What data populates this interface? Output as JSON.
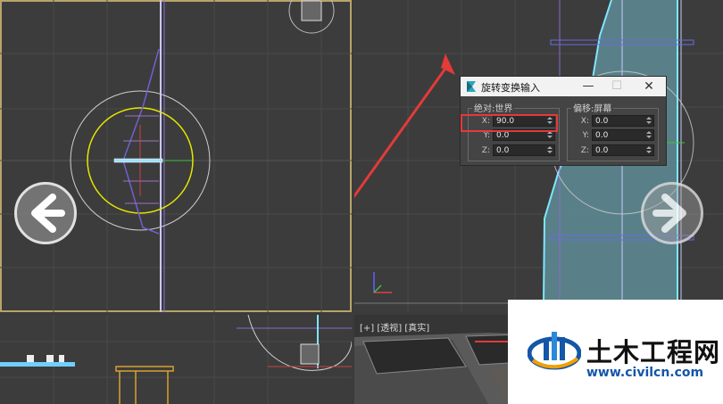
{
  "dialog": {
    "title": "旋转变换输入",
    "minimize_glyph": "—",
    "maximize_glyph": "☐",
    "close_glyph": "✕",
    "absolute": {
      "title": "绝对:世界",
      "x_label": "X:",
      "x_value": "90.0",
      "y_label": "Y:",
      "y_value": "0.0",
      "z_label": "Z:",
      "z_value": "0.0"
    },
    "offset": {
      "title": "偏移:屏幕",
      "x_label": "X:",
      "x_value": "0.0",
      "y_label": "Y:",
      "y_value": "0.0",
      "z_label": "Z:",
      "z_value": "0.0"
    }
  },
  "viewports": {
    "perspective_label": "[+] [透视] [真实]"
  },
  "navigation": {
    "prev_icon": "arrow-left-icon",
    "next_icon": "arrow-right-icon"
  },
  "watermark": {
    "brand": "土木工程网",
    "url": "www.civilcn.com"
  },
  "colors": {
    "highlight": "#e33a3a",
    "annotation_arrow": "#e33a3a",
    "active_viewport_border": "#b9a46a",
    "gizmo_yellow": "#e6e600",
    "brand_blue": "#1456a8"
  }
}
